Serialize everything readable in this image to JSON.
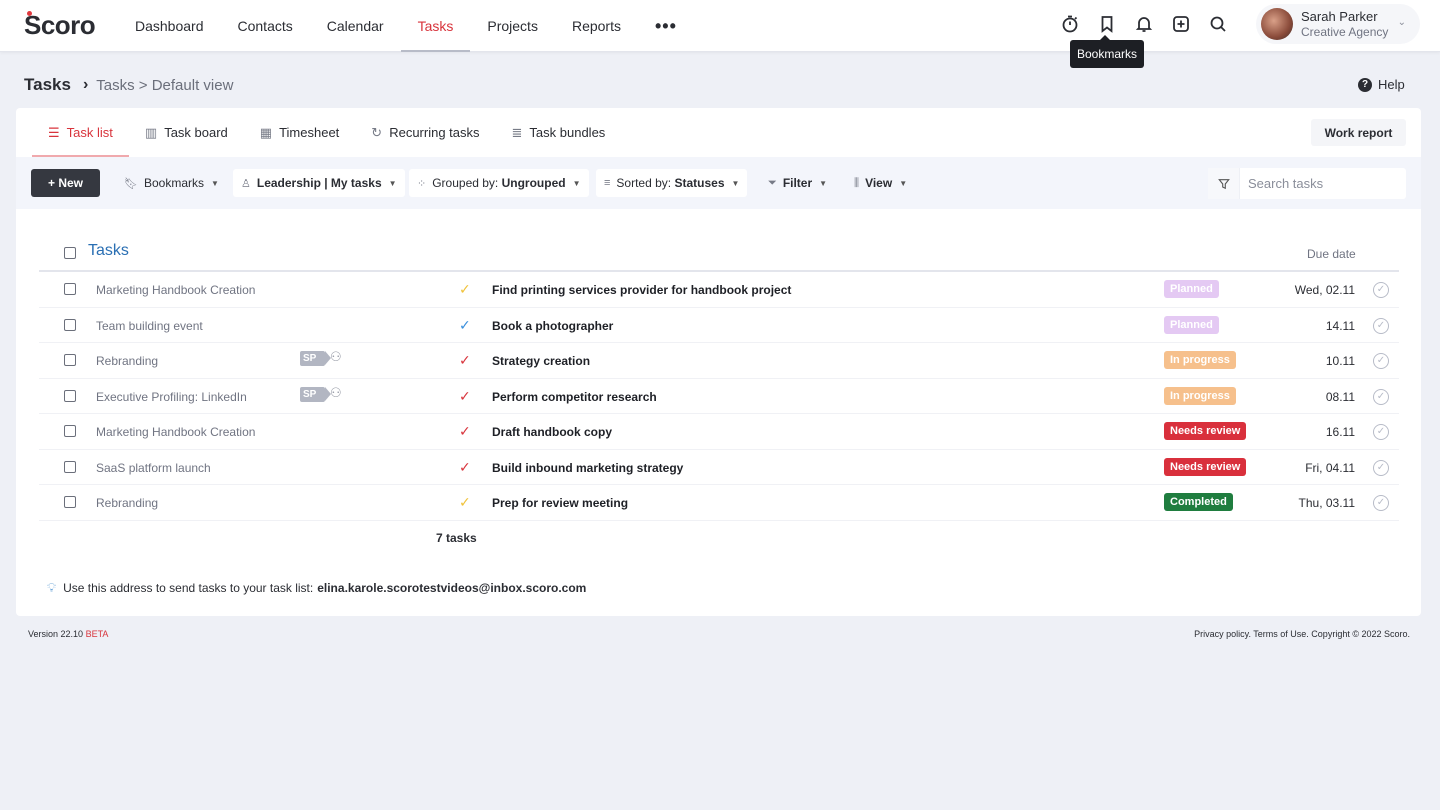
{
  "app": {
    "logo": "Scoro"
  },
  "nav": {
    "items": [
      {
        "label": "Dashboard",
        "active": false
      },
      {
        "label": "Contacts",
        "active": false
      },
      {
        "label": "Calendar",
        "active": false
      },
      {
        "label": "Tasks",
        "active": true
      },
      {
        "label": "Projects",
        "active": false
      },
      {
        "label": "Reports",
        "active": false
      }
    ],
    "more": "•••"
  },
  "top_icons": [
    "timer-icon",
    "bookmark-icon",
    "bell-icon",
    "add-icon",
    "search-icon"
  ],
  "tooltip": "Bookmarks",
  "user": {
    "name": "Sarah Parker",
    "org": "Creative Agency"
  },
  "breadcrumb": {
    "root": "Tasks",
    "sep": "›",
    "rest": "Tasks > Default view"
  },
  "help": "Help",
  "tabs": [
    {
      "label": "Task list",
      "icon": "list-icon",
      "active": true
    },
    {
      "label": "Task board",
      "icon": "board-icon",
      "active": false
    },
    {
      "label": "Timesheet",
      "icon": "grid-icon",
      "active": false
    },
    {
      "label": "Recurring tasks",
      "icon": "recurring-icon",
      "active": false
    },
    {
      "label": "Task bundles",
      "icon": "bundle-icon",
      "active": false
    }
  ],
  "work_report": "Work report",
  "toolbar": {
    "new": "+ New",
    "bookmarks": "Bookmarks",
    "view_filter": "Leadership | My tasks",
    "grouped_prefix": "Grouped by:",
    "grouped_value": "Ungrouped",
    "sorted_prefix": "Sorted by:",
    "sorted_value": "Statuses",
    "filter": "Filter",
    "view": "View",
    "search_placeholder": "Search tasks"
  },
  "table": {
    "title": "Tasks",
    "due_header": "Due date",
    "rows": [
      {
        "project": "Marketing Handbook Creation",
        "sp": false,
        "priority_color": "#f0c23a",
        "name": "Find printing services provider for handbook project",
        "status": "Planned",
        "status_bg": "#e4c9f3",
        "status_fg": "#ffffff",
        "due": "Wed, 02.11"
      },
      {
        "project": "Team building event",
        "sp": false,
        "priority_color": "#3a8fdc",
        "name": "Book a photographer",
        "status": "Planned",
        "status_bg": "#e4c9f3",
        "status_fg": "#ffffff",
        "due": "14.11"
      },
      {
        "project": "Rebranding",
        "sp": true,
        "sp_label": "SP",
        "priority_color": "#d8343c",
        "name": "Strategy creation",
        "status": "In progress",
        "status_bg": "#f6c08c",
        "status_fg": "#ffffff",
        "due": "10.11"
      },
      {
        "project": "Executive Profiling: LinkedIn",
        "sp": true,
        "sp_label": "SP",
        "priority_color": "#d8343c",
        "name": "Perform competitor research",
        "status": "In progress",
        "status_bg": "#f6c08c",
        "status_fg": "#ffffff",
        "due": "08.11"
      },
      {
        "project": "Marketing Handbook Creation",
        "sp": false,
        "priority_color": "#d8343c",
        "name": "Draft handbook copy",
        "status": "Needs review",
        "status_bg": "#d9303c",
        "status_fg": "#ffffff",
        "due": "16.11"
      },
      {
        "project": "SaaS platform launch",
        "sp": false,
        "priority_color": "#d8343c",
        "name": "Build inbound marketing strategy",
        "status": "Needs review",
        "status_bg": "#d9303c",
        "status_fg": "#ffffff",
        "due": "Fri, 04.11"
      },
      {
        "project": "Rebranding",
        "sp": false,
        "priority_color": "#f0c23a",
        "name": "Prep for review meeting",
        "status": "Completed",
        "status_bg": "#1f7d3f",
        "status_fg": "#ffffff",
        "due": "Thu, 03.11"
      }
    ],
    "count": "7 tasks"
  },
  "email_hint": {
    "text": "Use this address to send tasks to your task list:",
    "address": "elina.karole.scorotestvideos@inbox.scoro.com"
  },
  "footer": {
    "version": "Version 22.10",
    "beta": "BETA",
    "legal": "Privacy policy. Terms of Use. Copyright © 2022 Scoro."
  }
}
